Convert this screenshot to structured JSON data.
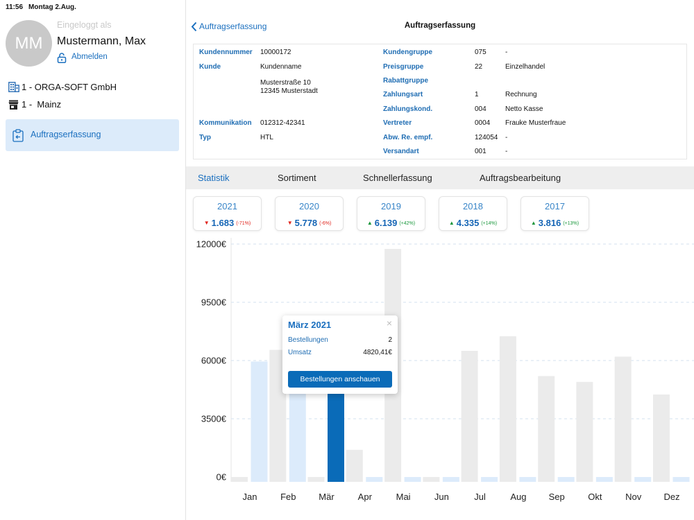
{
  "status_bar": {
    "time": "11:56",
    "date": "Montag 2.Aug."
  },
  "user": {
    "initials": "MM",
    "logged_in_label": "Eingeloggt als",
    "name": "Mustermann, Max",
    "logout_label": "Abmelden",
    "logout_icon": "unlock-icon"
  },
  "company": {
    "label": "1 - ORGA-SOFT GmbH",
    "icon": "building-icon"
  },
  "branch": {
    "label": "1 -  Mainz",
    "icon": "store-icon"
  },
  "nav": {
    "items": [
      {
        "label": "Auftragserfassung",
        "icon": "clipboard-icon",
        "selected": true
      }
    ]
  },
  "header": {
    "back_label": "Auftragserfassung",
    "back_icon": "chevron-left-icon",
    "title": "Auftragserfassung"
  },
  "customer": {
    "left": [
      {
        "label": "Kundennummer",
        "value": "10000172"
      },
      {
        "label": "Kunde",
        "value": "Kundenname",
        "address": [
          "Musterstraße 10",
          "12345 Musterstadt"
        ]
      },
      {
        "label": "Kommunikation",
        "value": "012312-42341"
      },
      {
        "label": "Typ",
        "value": "HTL"
      }
    ],
    "right": [
      {
        "label": "Kundengruppe",
        "code": "075",
        "text": "-"
      },
      {
        "label": "Preisgruppe",
        "code": "22",
        "text": "Einzelhandel"
      },
      {
        "label": "Rabattgruppe",
        "code": "",
        "text": ""
      },
      {
        "label": "Zahlungsart",
        "code": "1",
        "text": "Rechnung"
      },
      {
        "label": "Zahlungskond.",
        "code": "004",
        "text": "Netto Kasse"
      },
      {
        "label": "Vertreter",
        "code": "0004",
        "text": "Frauke Musterfraue"
      },
      {
        "label": "Abw. Re. empf.",
        "code": "124054",
        "text": "-"
      },
      {
        "label": "Versandart",
        "code": "001",
        "text": "-"
      }
    ]
  },
  "tabs": [
    {
      "label": "Statistik",
      "active": true
    },
    {
      "label": "Sortiment",
      "active": false
    },
    {
      "label": "Schnellerfassung",
      "active": false
    },
    {
      "label": "Auftragsbearbeitung",
      "active": false
    }
  ],
  "year_cards": [
    {
      "year": "2021",
      "arrow": "▼",
      "value": "1.683",
      "change": "(-71%)",
      "trend_color": "#e0231b"
    },
    {
      "year": "2020",
      "arrow": "▼",
      "value": "5.778",
      "change": "(-6%)",
      "trend_color": "#e0231b"
    },
    {
      "year": "2019",
      "arrow": "▲",
      "value": "6.139",
      "change": "(+42%)",
      "trend_color": "#17963a"
    },
    {
      "year": "2018",
      "arrow": "▲",
      "value": "4.335",
      "change": "(+14%)",
      "trend_color": "#17963a"
    },
    {
      "year": "2017",
      "arrow": "▲",
      "value": "3.816",
      "change": "(+13%)",
      "trend_color": "#17963a"
    }
  ],
  "popup": {
    "title": "März 2021",
    "close_glyph": "×",
    "rows": [
      {
        "label": "Bestellungen",
        "value": "2"
      },
      {
        "label": "Umsatz",
        "value": "4820,41€"
      }
    ],
    "button_label": "Bestellungen anschauen"
  },
  "colors": {
    "accent": "#1a6fbf",
    "selected_bar": "#0a6bb8",
    "nav_selected_bg": "#dcebfa",
    "tab_bar_bg": "#eeeeee"
  },
  "chart_data": {
    "type": "bar",
    "categories": [
      "Jan",
      "Feb",
      "Mär",
      "Apr",
      "Mai",
      "Jun",
      "Jul",
      "Aug",
      "Sep",
      "Okt",
      "Nov",
      "Dez"
    ],
    "series": [
      {
        "values": [
          0,
          6550,
          0,
          1400,
          11750,
          0,
          6500,
          7250,
          5200,
          4900,
          6200,
          4250
        ],
        "color": "#ebebeb"
      },
      {
        "values": [
          5950,
          5800,
          4820.41,
          0,
          0,
          0,
          0,
          0,
          0,
          0,
          0,
          0
        ],
        "color": "#dcebfb",
        "highlight_index": 2,
        "highlight_color": "#0a6bb8"
      }
    ],
    "ylim": [
      0,
      12000
    ],
    "ytick_labels": [
      "0€",
      "3500€",
      "6000€",
      "9500€",
      "12000€"
    ],
    "grid": true
  }
}
